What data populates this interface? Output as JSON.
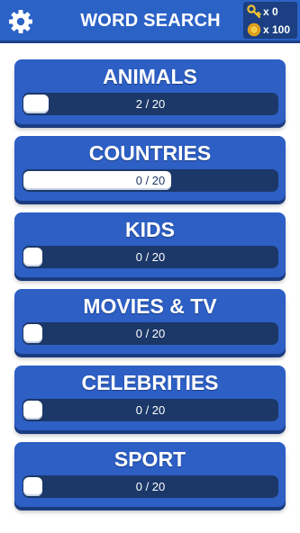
{
  "header": {
    "title": "WORD SEARCH",
    "keys": "x 0",
    "coins": "x 100"
  },
  "colors": {
    "brand_blue": "#2b62c6",
    "card_blue": "#2d5fc5",
    "track_navy": "#1b3868",
    "key_gold": "#f2c230",
    "coin_gold": "#e5a51c"
  },
  "icons": {
    "settings": "gear-icon",
    "keys": "key-icon",
    "coins": "coin-icon"
  },
  "categories": [
    {
      "label": "ANIMALS",
      "progress_text": "2 / 20",
      "progress": 0.1
    },
    {
      "label": "COUNTRIES",
      "progress_text": "0 / 20",
      "progress": 0.58
    },
    {
      "label": "KIDS",
      "progress_text": "0 / 20",
      "progress": 0
    },
    {
      "label": "MOVIES & TV",
      "progress_text": "0 / 20",
      "progress": 0
    },
    {
      "label": "CELEBRITIES",
      "progress_text": "0 / 20",
      "progress": 0
    },
    {
      "label": "SPORT",
      "progress_text": "0 / 20",
      "progress": 0
    }
  ]
}
